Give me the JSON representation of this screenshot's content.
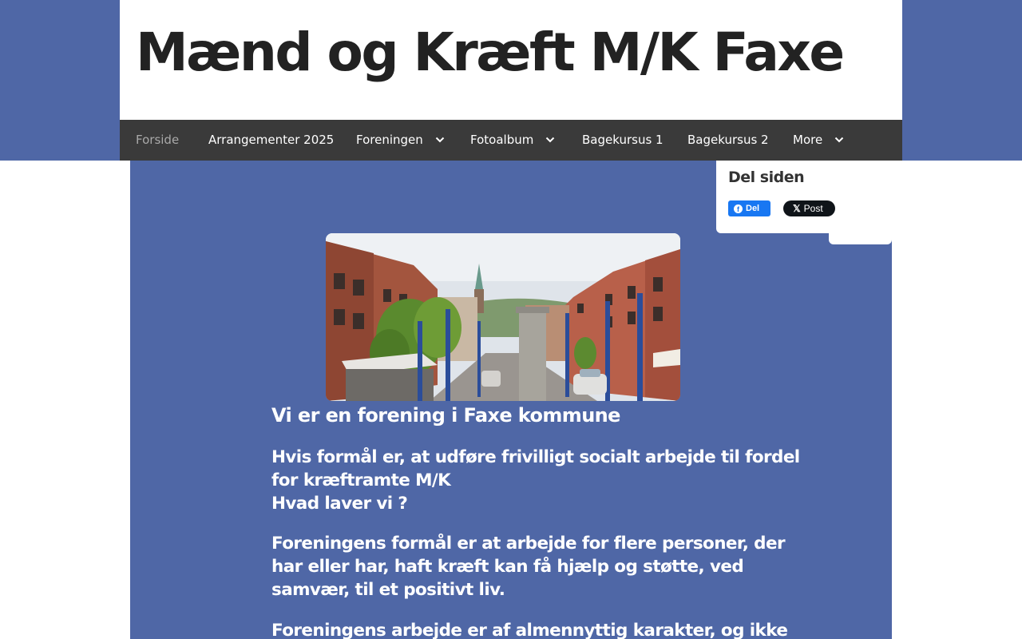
{
  "header": {
    "site_title": "Mænd og Kræft M/K Faxe"
  },
  "nav": {
    "items": [
      {
        "label": "Forside",
        "active": true
      },
      {
        "label": "Arrangementer 2025"
      },
      {
        "label": "Foreningen",
        "has_dropdown": true
      },
      {
        "label": "Fotoalbum",
        "has_dropdown": true
      },
      {
        "label": "Bagekursus 1"
      },
      {
        "label": "Bagekursus 2"
      },
      {
        "label": "More",
        "has_dropdown": true
      }
    ]
  },
  "share": {
    "title": "Del siden",
    "facebook_label": "Del",
    "x_label": "Post"
  },
  "hero_image": {
    "description": "street-scene-image"
  },
  "content": {
    "heading": "Vi er en forening i Faxe kommune",
    "purpose_line1": "Hvis formål er, at udføre frivilligt socialt arbejde til fordel for kræftramte M/K",
    "purpose_line2": "Hvad laver vi ?",
    "paragraph1": "Foreningens formål er at arbejde for flere personer, der har eller har, haft kræft kan få hjælp og støtte, ved samvær, til et positivt liv.",
    "paragraph2": "Foreningens arbejde er af almennyttig karakter, og ikke"
  },
  "colors": {
    "brand_blue": "#4f67a6",
    "nav_bg": "#3a3a3a",
    "facebook_blue": "#1877f2",
    "x_black": "#0f1419"
  }
}
